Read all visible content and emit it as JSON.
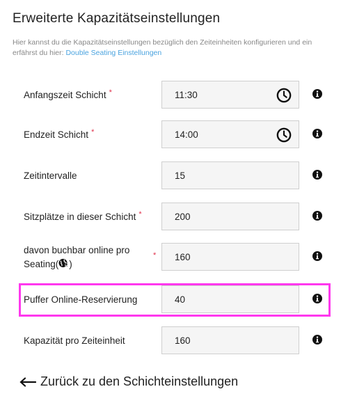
{
  "header": {
    "title": "Erweiterte Kapazitätseinstellungen",
    "intro_text": "Hier kannst du die Kapazitätseinstellungen bezüglich den Zeiteinheiten konfigurieren und ein erfährst du hier:",
    "intro_link": "Double Seating Einstellungen"
  },
  "form": {
    "rows": [
      {
        "label": "Anfangszeit Schicht",
        "required": "*",
        "value": "11:30",
        "icon": "clock-icon"
      },
      {
        "label": "Endzeit Schicht",
        "required": "*",
        "value": "14:00",
        "icon": "clock-icon"
      },
      {
        "label": "Zeitintervalle",
        "value": "15"
      },
      {
        "label": "Sitzplätze in dieser Schicht",
        "required": "*",
        "value": "200"
      },
      {
        "label": "davon buchbar online pro Seating(",
        "label_suffix": ")",
        "required": "*",
        "value": "160"
      },
      {
        "label": "Puffer Online-Reservierung",
        "value": "40"
      },
      {
        "label": "Kapazität pro Zeiteinheit",
        "value": "160"
      }
    ]
  },
  "footer": {
    "back_label": "Zurück zu den Schichteinstellungen"
  },
  "colors": {
    "link": "#4aa3df",
    "required": "#e0314b",
    "highlight": "#ff38ee"
  }
}
